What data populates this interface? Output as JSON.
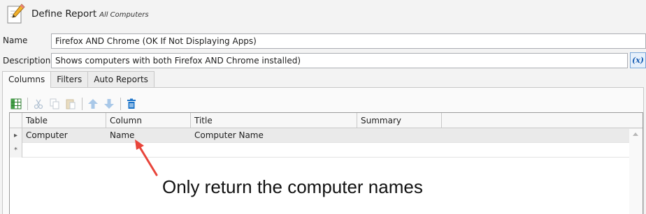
{
  "window": {
    "title": "Define Report",
    "subtitle": "All Computers"
  },
  "form": {
    "name_label": "Name",
    "name_value": "Firefox AND Chrome (OK If Not Displaying Apps)",
    "description_label": "Description",
    "description_value": "Shows computers with both Firefox AND Chrome installed)",
    "expression_button": "(x)"
  },
  "tabs": [
    {
      "label": "Columns",
      "active": true
    },
    {
      "label": "Filters",
      "active": false
    },
    {
      "label": "Auto Reports",
      "active": false
    }
  ],
  "toolbar": {
    "icons": [
      "add-column-icon",
      "cut-icon",
      "copy-icon",
      "paste-icon",
      "move-up-icon",
      "move-down-icon",
      "delete-icon"
    ]
  },
  "grid": {
    "columns": [
      "Table",
      "Column",
      "Title",
      "Summary"
    ],
    "rows": [
      {
        "marker": "▸",
        "cells": [
          "Computer",
          "Name",
          "Computer Name",
          ""
        ]
      }
    ],
    "new_row_marker": "*"
  },
  "annotation": {
    "text": "Only return the computer names",
    "color": "#e8443a"
  }
}
